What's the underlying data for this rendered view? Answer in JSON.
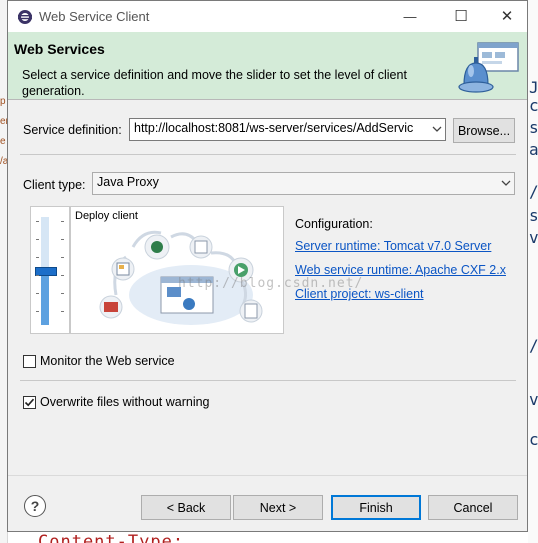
{
  "window": {
    "title": "Web Service Client",
    "minimize_glyph": "—",
    "maximize_glyph": "☐",
    "close_glyph": "✕"
  },
  "banner": {
    "title": "Web Services",
    "description": "Select a service definition and move the slider to set the level of client generation."
  },
  "service_definition": {
    "label": "Service definition:",
    "value": "http://localhost:8081/ws-server/services/AddServic",
    "browse_label": "Browse..."
  },
  "client_type": {
    "label": "Client type:",
    "selected": "Java Proxy"
  },
  "slider": {
    "level_fraction": 0.5
  },
  "preview": {
    "label": "Deploy client"
  },
  "configuration": {
    "heading": "Configuration:",
    "server_runtime": "Server runtime: Tomcat v7.0 Server",
    "web_service_runtime": "Web service runtime: Apache CXF 2.x",
    "client_project": "Client project: ws-client"
  },
  "options": {
    "monitor_label": "Monitor the Web service",
    "monitor_checked": false,
    "overwrite_label": "Overwrite files without warning",
    "overwrite_checked": true
  },
  "buttons": {
    "back": "< Back",
    "next": "Next >",
    "finish": "Finish",
    "cancel": "Cancel"
  },
  "watermark": "http://blog.csdn.net/",
  "background": {
    "bottom_text": "Content-Type:"
  },
  "colors": {
    "banner_bg": "#d4ebd8",
    "link": "#0b55c4",
    "slider_thumb": "#1c6ec9"
  }
}
